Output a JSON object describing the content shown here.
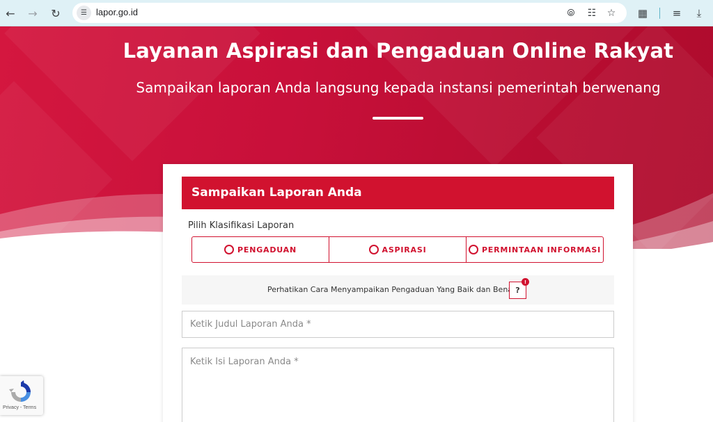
{
  "browser": {
    "url": "lapor.go.id",
    "back_icon": "arrow-left-icon",
    "forward_icon": "arrow-right-icon",
    "reload_icon": "reload-icon"
  },
  "hero": {
    "title": "Layanan Aspirasi dan Pengaduan Online Rakyat",
    "subtitle": "Sampaikan laporan Anda langsung kepada instansi pemerintah berwenang"
  },
  "form": {
    "header": "Sampaikan Laporan Anda",
    "classification_label": "Pilih Klasifikasi Laporan",
    "options": [
      {
        "label": "PENGADUAN",
        "selected": false
      },
      {
        "label": "ASPIRASI",
        "selected": false
      },
      {
        "label": "PERMINTAAN INFORMASI",
        "selected": false
      }
    ],
    "notice": "Perhatikan Cara Menyampaikan Pengaduan Yang Baik dan Benar",
    "help_label": "?",
    "help_badge": "!",
    "title_placeholder": "Ketik Judul Laporan Anda *",
    "body_placeholder": "Ketik Isi Laporan Anda *"
  },
  "recaptcha": {
    "links": "Privacy - Terms"
  },
  "colors": {
    "brand_red": "#d1122f",
    "hero_red": "#c8103a"
  }
}
